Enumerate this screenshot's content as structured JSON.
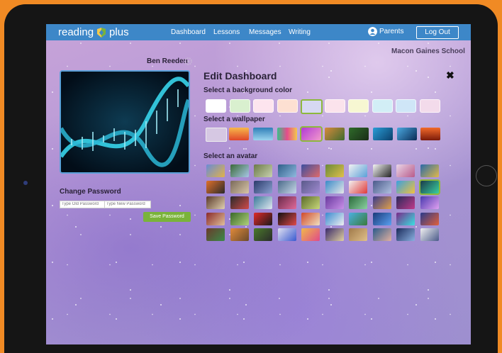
{
  "app": {
    "logo_text": "reading",
    "logo_text_2": "plus"
  },
  "nav": {
    "items": [
      {
        "label": "Dashboard"
      },
      {
        "label": "Lessons"
      },
      {
        "label": "Messages"
      },
      {
        "label": "Writing"
      }
    ],
    "parents_label": "Parents",
    "logout_label": "Log Out"
  },
  "school": "Macon Gaines School",
  "profile": {
    "name": "Ben Reeden"
  },
  "password": {
    "title": "Change Password",
    "old_placeholder": "Type Old Password",
    "new_placeholder": "Type New Password",
    "save_label": "Save Password"
  },
  "edit": {
    "title": "Edit Dashboard",
    "bg_label": "Select a background color",
    "wallpaper_label": "Select a wallpaper",
    "avatar_label": "Select an avatar"
  },
  "background_colors": [
    "#ffffff",
    "#d9f0cf",
    "#fde4ee",
    "#fde0d2",
    "#d6d8f2",
    "#fbe3ec",
    "#f7f7d2",
    "#d2eef6",
    "#cfe6f7",
    "#f3dbeb"
  ],
  "selected_background": "#d6d8f2",
  "colors": {
    "nav": "#3d87c8",
    "accent_green": "#7ab33a",
    "frame": "#f08a24"
  }
}
